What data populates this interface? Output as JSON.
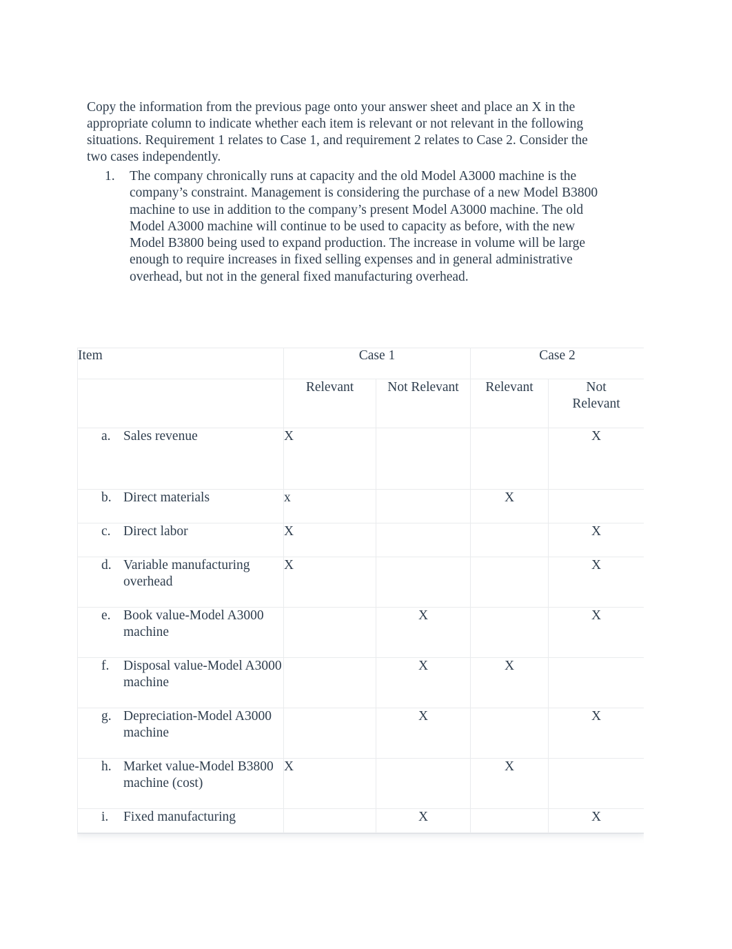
{
  "document": {
    "intro_paragraph": "Copy the information from the previous page onto your answer sheet and place an X in the appropriate column to indicate whether each item is relevant or not relevant in the following situations. Requirement 1 relates to Case 1, and requirement 2 relates to Case 2. Consider the two cases independently.",
    "list": [
      {
        "marker": "1.",
        "text": "The company chronically runs at capacity and the old Model A3000 machine is the company’s constraint. Management is considering the purchase of a new Model B3800 machine to use in addition to the company’s present Model A3000 machine. The old Model A3000 machine will continue to be used to capacity as before, with the new Model B3800 being used to expand production. The increase in volume will be large enough to require increases in fixed selling expenses and in general administrative overhead, but not in the general fixed manufacturing overhead."
      }
    ]
  },
  "table": {
    "headers": {
      "item": "Item",
      "case1": "Case 1",
      "case2": "Case 2",
      "case1_relevant": "Relevant",
      "case1_not_relevant": "Not Relevant",
      "case2_relevant": "Relevant",
      "case2_not_relevant": "Not Relevant"
    },
    "rows": [
      {
        "letter": "a.",
        "label": "Sales revenue",
        "case1_relevant": "X",
        "case1_not_relevant": "",
        "case2_relevant": "",
        "case2_not_relevant": "X"
      },
      {
        "letter": "b.",
        "label": "Direct materials",
        "case1_relevant": "x",
        "case1_not_relevant": "",
        "case2_relevant": "X",
        "case2_not_relevant": ""
      },
      {
        "letter": "c.",
        "label": "Direct labor",
        "case1_relevant": "X",
        "case1_not_relevant": "",
        "case2_relevant": "",
        "case2_not_relevant": "X"
      },
      {
        "letter": "d.",
        "label": "Variable manufacturing overhead",
        "case1_relevant": "X",
        "case1_not_relevant": "",
        "case2_relevant": "",
        "case2_not_relevant": "X"
      },
      {
        "letter": "e.",
        "label": "Book value-Model A3000 machine",
        "case1_relevant": "",
        "case1_not_relevant": "X",
        "case2_relevant": "",
        "case2_not_relevant": "X"
      },
      {
        "letter": "f.",
        "label": "Disposal value-Model A3000 machine",
        "case1_relevant": "",
        "case1_not_relevant": "X",
        "case2_relevant": "X",
        "case2_not_relevant": ""
      },
      {
        "letter": "g.",
        "label": "Depreciation-Model A3000 machine",
        "case1_relevant": "",
        "case1_not_relevant": "X",
        "case2_relevant": "",
        "case2_not_relevant": "X"
      },
      {
        "letter": "h.",
        "label": "Market value-Model B3800 machine (cost)",
        "case1_relevant": "X",
        "case1_not_relevant": "",
        "case2_relevant": "X",
        "case2_not_relevant": ""
      },
      {
        "letter": "i.",
        "label": "Fixed manufacturing",
        "case1_relevant": "",
        "case1_not_relevant": "X",
        "case2_relevant": "",
        "case2_not_relevant": "X"
      }
    ]
  },
  "colors": {
    "text": "#2f3e4e",
    "page_background": "#ffffff",
    "table_border": "#e9ebed"
  }
}
